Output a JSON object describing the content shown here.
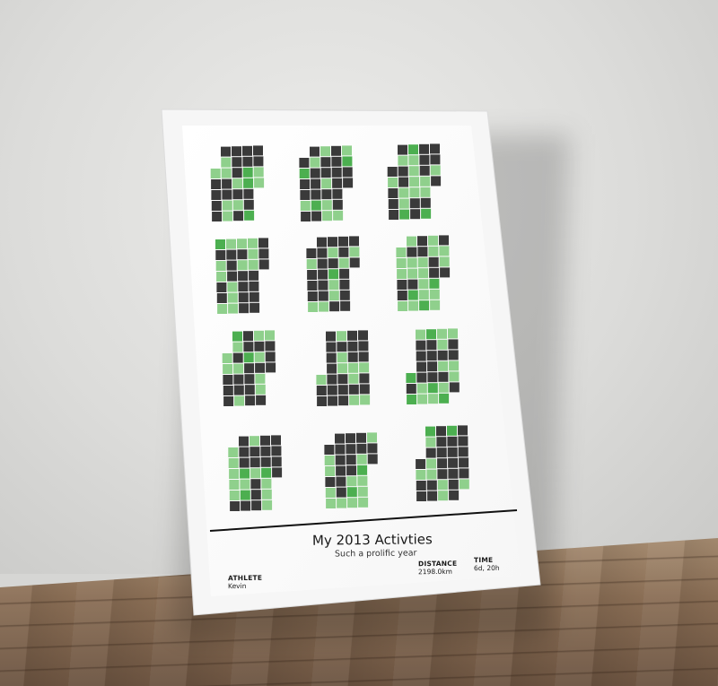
{
  "poster": {
    "title": "My 2013 Activties",
    "subtitle": "Such a prolific year",
    "athlete_label": "ATHLETE",
    "athlete_value": "Kevin",
    "distance_label": "DISTANCE",
    "distance_value": "2198.0km",
    "time_label": "TIME",
    "time_value": "6d, 20h"
  },
  "colors": {
    "dark": "#3a3a3a",
    "light_green": "#8fd08c",
    "green": "#4caf50",
    "frame": "#f4f4f4",
    "paper": "#ffffff"
  }
}
